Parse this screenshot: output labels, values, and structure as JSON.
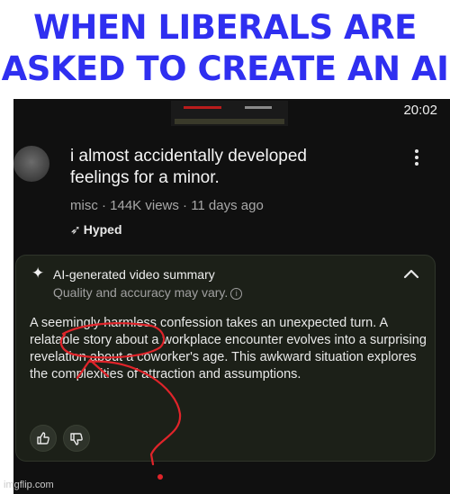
{
  "caption": {
    "line1": "WHEN LIBERALS ARE",
    "line2": "ASKED TO CREATE AN AI",
    "color": "#2f2ff0"
  },
  "status_bar": {
    "time": "20:02"
  },
  "video": {
    "title": "i almost accidentally developed feelings for a minor.",
    "meta": "misc · 144K views · 11 days ago",
    "badge": "Hyped",
    "badge_icon": "hype-icon"
  },
  "summary_card": {
    "icon": "sparkle-icon",
    "title": "AI-generated video summary",
    "subtitle": "Quality and accuracy may vary.",
    "body": "A seemingly harmless confession takes an unexpected turn. A relatable story about a workplace encounter evolves into a surprising revelation about a coworker's age. This awkward situation explores the complexities of attraction and assumptions.",
    "like_icon": "thumbs-up-icon",
    "dislike_icon": "thumbs-down-icon",
    "background": "#1c2018"
  },
  "annotation": {
    "color": "#e0242a"
  },
  "watermark": "imgflip.com"
}
